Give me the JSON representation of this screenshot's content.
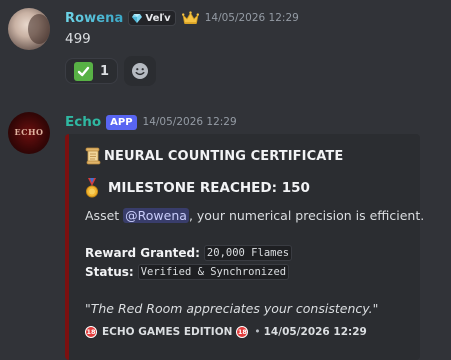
{
  "messages": [
    {
      "author": "Rowena",
      "guild_tag": "Veľv",
      "timestamp": "14/05/2026 12:29",
      "content": "499",
      "reactions": [
        {
          "emoji": "white-check-mark",
          "count": "1"
        }
      ]
    },
    {
      "author": "Echo",
      "badge": "APP",
      "timestamp": "14/05/2026 12:29",
      "avatar_text": "ECHO",
      "embed": {
        "accent_color": "#7b1010",
        "title": "NEURAL COUNTING CERTIFICATE",
        "heading": "MILESTONE REACHED: 150",
        "line_prefix": "Asset ",
        "mention": "@Rowena",
        "line_suffix": ", your numerical precision is efficient.",
        "fields": [
          {
            "label": "Reward Granted:",
            "value": "20,000 Flames"
          },
          {
            "label": "Status:",
            "value": "Verified & Synchronized"
          }
        ],
        "quote": "\"The Red Room appreciates your consistency.\"",
        "footer": {
          "icon_text": "18",
          "text": "ECHO GAMES EDITION",
          "separator": "•",
          "timestamp": "14/05/2026 12:29"
        }
      }
    }
  ],
  "colors": {
    "background": "#313338",
    "embed_background": "#2b2d31",
    "app_badge": "#5865f2",
    "echo_name": "#2fb8a2",
    "rowena_name": "#3aa7c7"
  }
}
